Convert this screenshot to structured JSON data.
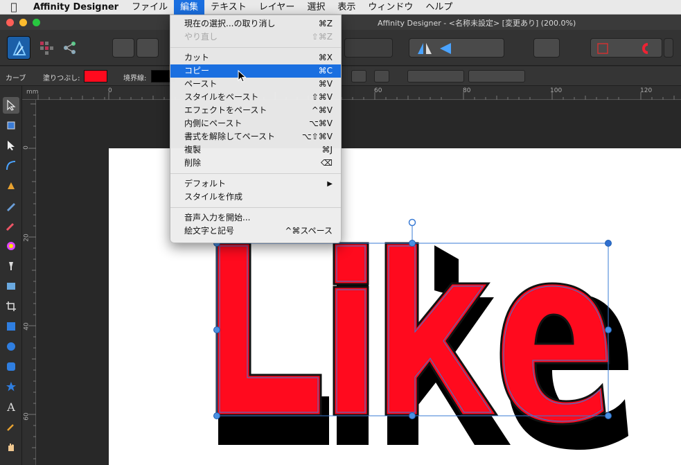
{
  "menubar": {
    "app_name": "Affinity Designer",
    "items": [
      "ファイル",
      "編集",
      "テキスト",
      "レイヤー",
      "選択",
      "表示",
      "ウィンドウ",
      "ヘルプ"
    ],
    "active_item": "編集"
  },
  "window": {
    "title": "Affinity Designer - <名称未設定> [変更あり] (200.0%)"
  },
  "context_toolbar": {
    "curve_label": "カーブ",
    "fill_label": "塗りつぶし:",
    "stroke_label": "境界線:",
    "fill_color": "#ff0a1e",
    "stroke_color": "#000000"
  },
  "ruler": {
    "unit": "mm",
    "h_ticks": [
      "0",
      "60",
      "80",
      "100",
      "120"
    ],
    "v_ticks": [
      "0",
      "20",
      "40",
      "60"
    ]
  },
  "artwork": {
    "text": "Like",
    "fill_color": "#ff0a1e",
    "shadow_color": "#000000",
    "outline_color": "#3a7bd5"
  },
  "edit_menu": {
    "groups": [
      [
        {
          "label": "現在の選択...の取り消し",
          "shortcut": "⌘Z",
          "enabled": true
        },
        {
          "label": "やり直し",
          "shortcut": "⇧⌘Z",
          "enabled": false
        }
      ],
      [
        {
          "label": "カット",
          "shortcut": "⌘X",
          "enabled": true
        },
        {
          "label": "コピー",
          "shortcut": "⌘C",
          "enabled": true,
          "highlighted": true
        },
        {
          "label": "ペースト",
          "shortcut": "⌘V",
          "enabled": true
        },
        {
          "label": "スタイルをペースト",
          "shortcut": "⇧⌘V",
          "enabled": true
        },
        {
          "label": "エフェクトをペースト",
          "shortcut": "^⌘V",
          "enabled": true
        },
        {
          "label": "内側にペースト",
          "shortcut": "⌥⌘V",
          "enabled": true
        },
        {
          "label": "書式を解除してペースト",
          "shortcut": "⌥⇧⌘V",
          "enabled": true
        },
        {
          "label": "複製",
          "shortcut": "⌘J",
          "enabled": true
        },
        {
          "label": "削除",
          "shortcut": "⌫",
          "enabled": true
        }
      ],
      [
        {
          "label": "デフォルト",
          "shortcut": "▶",
          "enabled": true
        },
        {
          "label": "スタイルを作成",
          "shortcut": "",
          "enabled": true
        }
      ],
      [
        {
          "label": "音声入力を開始...",
          "shortcut": "",
          "enabled": true
        },
        {
          "label": "絵文字と記号",
          "shortcut": "^⌘スペース",
          "enabled": true
        }
      ]
    ]
  },
  "icons": [
    "apple-icon",
    "affinity-logo-icon",
    "pixel-persona-icon",
    "export-persona-icon",
    "move-tool-icon",
    "artboard-tool-icon",
    "node-tool-icon",
    "pen-tool-icon",
    "pencil-tool-icon",
    "brush-tool-icon",
    "color-picker-icon",
    "text-tool-icon",
    "hand-tool-icon",
    "pointer-cursor-icon"
  ]
}
